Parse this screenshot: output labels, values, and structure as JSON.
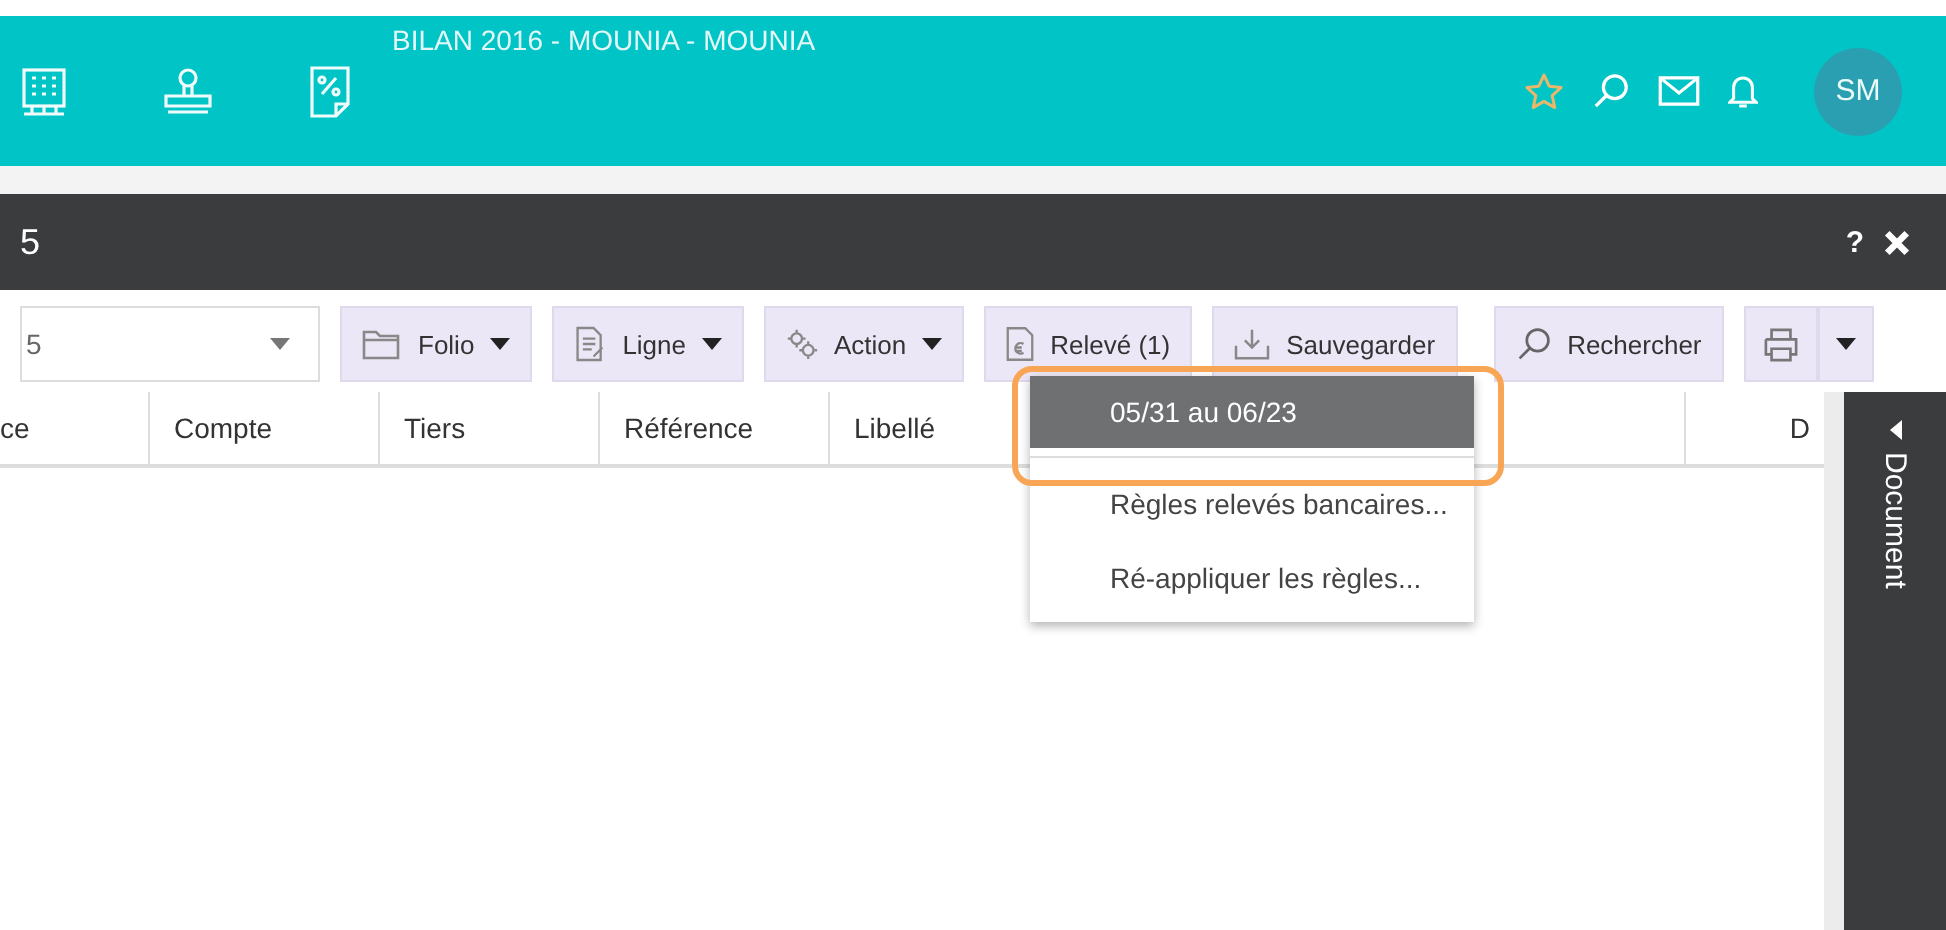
{
  "header": {
    "title": "BILAN 2016 - MOUNIA - MOUNIA",
    "apps": [
      {
        "kind": "building"
      },
      {
        "kind": "stamp"
      },
      {
        "kind": "percent"
      }
    ],
    "avatar": "SM"
  },
  "window": {
    "title": "5",
    "help": "?"
  },
  "toolbar": {
    "select_value": "5",
    "buttons": [
      {
        "label": "Folio",
        "kind": "folder",
        "dropdown": true
      },
      {
        "label": "Ligne",
        "kind": "document",
        "dropdown": true
      },
      {
        "label": "Action",
        "kind": "gears",
        "dropdown": true
      },
      {
        "label": "Relevé (1)",
        "kind": "statement",
        "dropdown": false
      },
      {
        "label": "Sauvegarder",
        "kind": "download",
        "dropdown": false
      },
      {
        "label": "Rechercher",
        "kind": "search",
        "dropdown": false
      }
    ]
  },
  "table": {
    "columns": [
      "ce",
      "Compte",
      "Tiers",
      "Référence",
      "Libellé",
      "D"
    ]
  },
  "menu": {
    "items": [
      {
        "label": "05/31 au 06/23",
        "selected": true
      },
      {
        "label": "Règles relevés bancaires...",
        "selected": false
      },
      {
        "label": "Ré-appliquer les règles...",
        "selected": false
      }
    ]
  },
  "side_panel": {
    "label": "Document"
  }
}
